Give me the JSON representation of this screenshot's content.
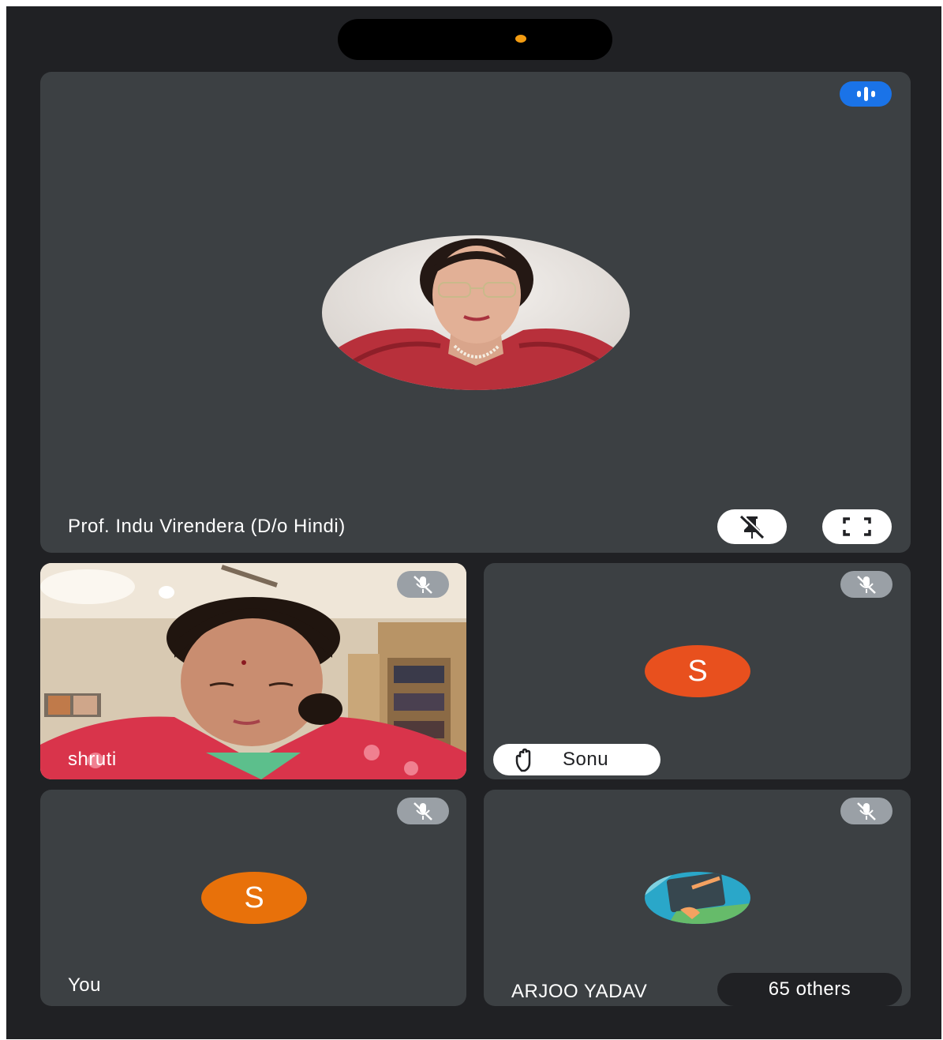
{
  "main_tile": {
    "name": "Prof. Indu Virendera (D/o Hindi)",
    "speaking_icon": "audio-wave-icon",
    "unpin_icon": "unpin-icon",
    "fullscreen_icon": "fullscreen-icon"
  },
  "tiles": {
    "shruti": {
      "name": "shruti",
      "mic_icon": "mic-off-icon"
    },
    "sonu": {
      "name": "Sonu",
      "avatar_letter": "S",
      "avatar_color": "#e8501e",
      "mic_icon": "mic-off-icon",
      "hand_icon": "raised-hand-icon"
    },
    "you": {
      "name": "You",
      "avatar_letter": "S",
      "avatar_color": "#e8710a",
      "mic_icon": "mic-off-icon"
    },
    "arjoo": {
      "name": "ARJOO YADAV",
      "others": "65 others",
      "mic_icon": "mic-off-icon"
    }
  },
  "colors": {
    "background": "#202124",
    "tile": "#3c4043",
    "accent": "#1a73e8",
    "status_dot": "#f39c12"
  }
}
